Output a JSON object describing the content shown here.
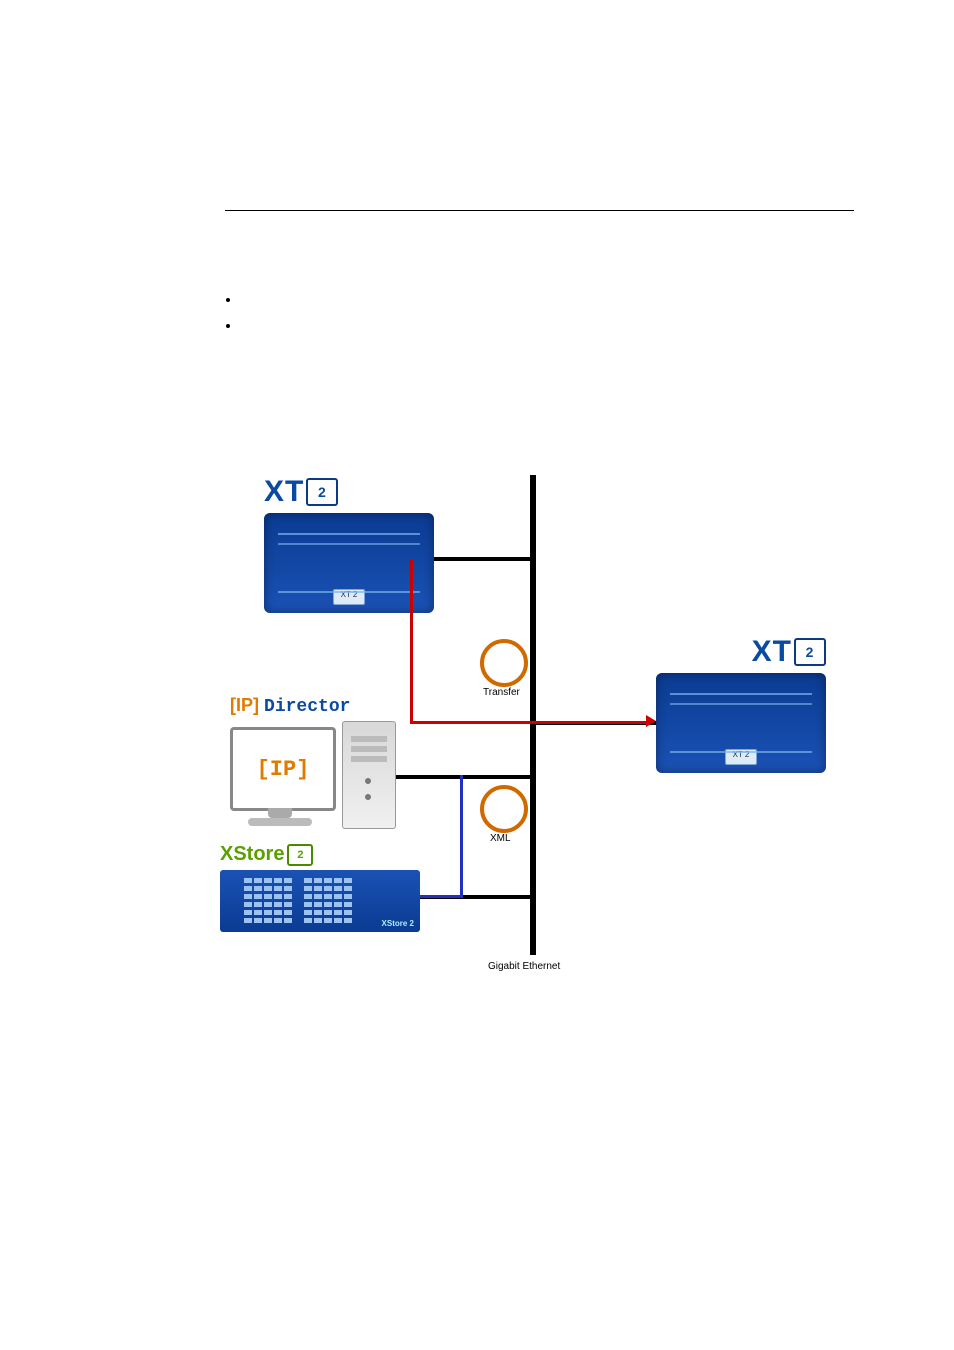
{
  "bullets": {
    "b1": "",
    "b2": ""
  },
  "diagram": {
    "xt_label": "XT",
    "xt_chip": "2",
    "ipd_ip": "[IP]",
    "ipd_dir": "Director",
    "mon_ip": "[IP]",
    "xstore_label": "XStore",
    "xstore_chip": "2",
    "xstore_badge": "XStore 2",
    "transfer": "Transfer",
    "xml": "XML",
    "eth": "Gigabit Ethernet",
    "xt_badge": "XT 2"
  }
}
